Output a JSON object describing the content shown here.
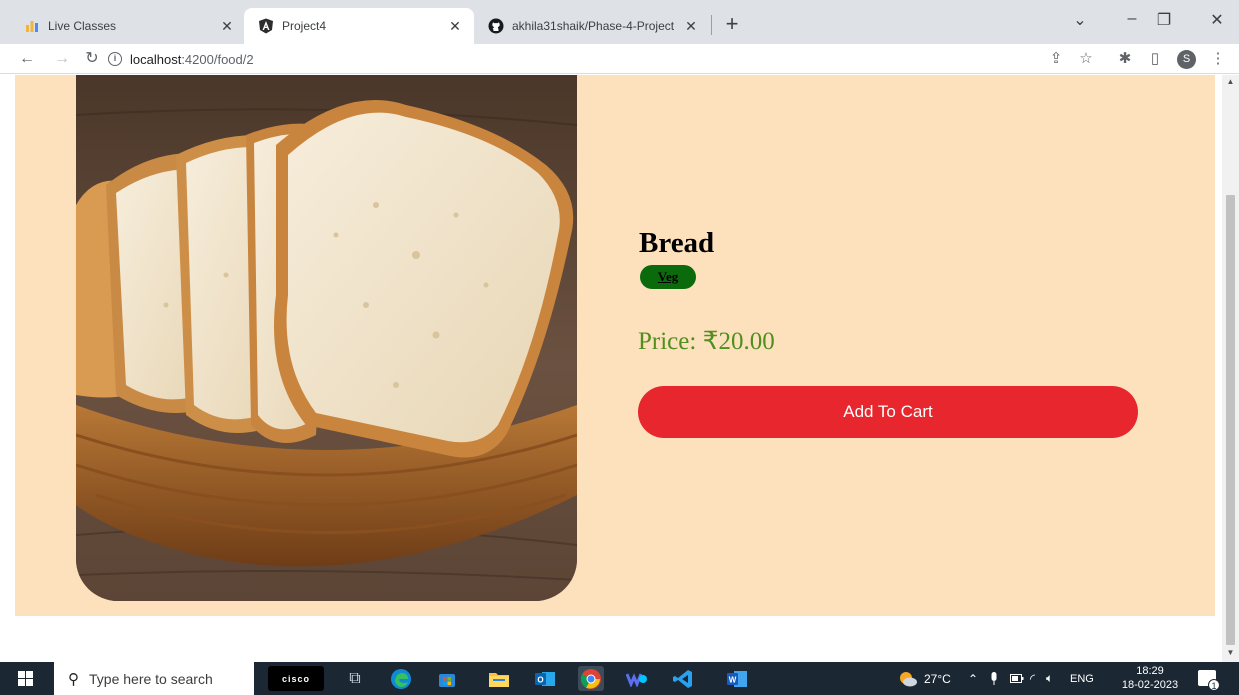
{
  "browser": {
    "tabs": [
      {
        "label": "Live Classes",
        "icon": "live-classes-favicon"
      },
      {
        "label": "Project4",
        "icon": "angular-favicon"
      },
      {
        "label": "akhila31shaik/Phase-4-Project",
        "icon": "github-favicon"
      }
    ],
    "url_host": "localhost",
    "url_path": ":4200/food/2",
    "profile_initial": "S"
  },
  "food": {
    "name": "Bread",
    "tag": "Veg",
    "price": "Price: ₹20.00",
    "add_to_cart": "Add To Cart",
    "image": "bread-slices-in-basket"
  },
  "taskbar": {
    "search_placeholder": "Type here to search",
    "cisco_label": "cisco",
    "weather": "27°C",
    "language": "ENG",
    "time": "18:29",
    "date": "18-02-2023",
    "notification_count": "1"
  },
  "colors": {
    "panel_bg": "#fde1bd",
    "tag_bg": "#0b6a0b",
    "price": "#4f8f1e",
    "add_button": "#e8262d",
    "taskbar": "#1b2733"
  }
}
